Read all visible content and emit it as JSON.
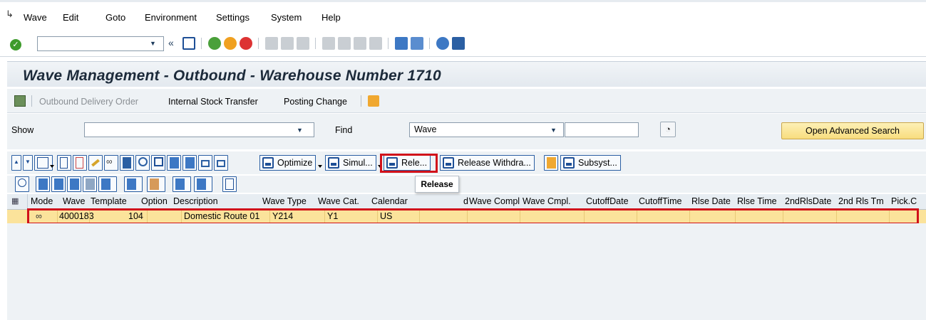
{
  "menu": {
    "items": [
      "Wave",
      "Edit",
      "Goto",
      "Environment",
      "Settings",
      "System",
      "Help"
    ]
  },
  "standard_toolbar": {
    "command_field_value": ""
  },
  "title": "Wave Management - Outbound - Warehouse Number 1710",
  "app_toolbar": {
    "outbound_delivery_order": "Outbound Delivery Order",
    "internal_stock_transfer": "Internal Stock Transfer",
    "posting_change": "Posting Change"
  },
  "search": {
    "show_label": "Show",
    "show_value": "",
    "find_label": "Find",
    "find_value": "Wave",
    "find_input_value": "",
    "advanced_button": "Open Advanced Search"
  },
  "alv_toolbar": {
    "optimize": "Optimize",
    "simulate": "Simul...",
    "release": "Rele...",
    "release_withdraw": "Release Withdra...",
    "subsystem": "Subsyst..."
  },
  "tooltip": "Release",
  "grid": {
    "columns": [
      "Mode",
      "Wave",
      "Template",
      "Option",
      "Description",
      "Wave Type",
      "Wave Cat.",
      "Calendar",
      "d",
      "Wave Compl",
      "Wave Cmpl.",
      "CutoffDate",
      "CutoffTime",
      "Rlse Date",
      "Rlse Time",
      "2ndRlsDate",
      "2nd Rls Tm",
      "Pick.C"
    ],
    "rows": [
      {
        "wave": "4000183",
        "template": "104",
        "option": "",
        "description": "Domestic Route 01",
        "wave_type": "Y214",
        "wave_cat": "Y1",
        "calendar": "US"
      }
    ]
  },
  "colors": {
    "selected_row": "#fbe39b",
    "highlight": "#d1111a",
    "advanced_button": "#f8dd7e",
    "title_bg": "#e3e9ef"
  }
}
